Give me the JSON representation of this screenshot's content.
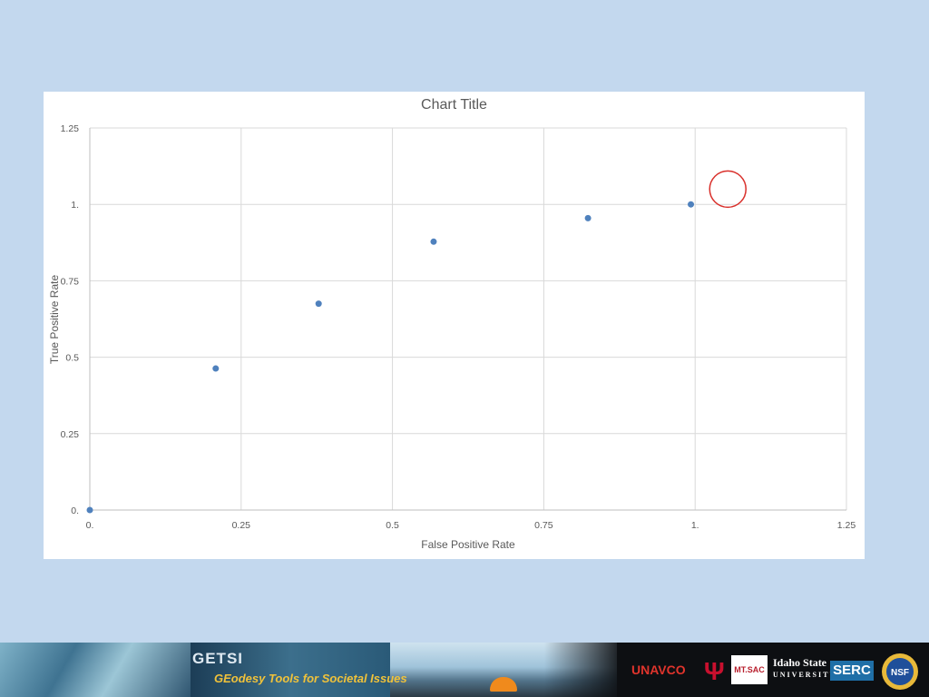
{
  "chart_data": {
    "type": "scatter",
    "title": "Chart Title",
    "xlabel": "False Positive Rate",
    "ylabel": "True Positive Rate",
    "xlim": [
      0,
      1.25
    ],
    "ylim": [
      0,
      1.25
    ],
    "x_ticks": [
      "0.",
      "0.25",
      "0.5",
      "0.75",
      "1.",
      "1.25"
    ],
    "y_ticks": [
      "0.",
      "0.25",
      "0.5",
      "0.75",
      "1.",
      "1.25"
    ],
    "grid": true,
    "series": [
      {
        "points": [
          {
            "x": 0,
            "y": 0
          },
          {
            "x": 0.208,
            "y": 0.463
          },
          {
            "x": 0.378,
            "y": 0.675
          },
          {
            "x": 0.568,
            "y": 0.878
          },
          {
            "x": 0.823,
            "y": 0.955
          },
          {
            "x": 0.993,
            "y": 1.0
          }
        ]
      }
    ],
    "annotation": {
      "type": "circle",
      "x": 1.054,
      "y": 1.05,
      "color": "#d9302b"
    },
    "colors": {
      "marker": "#4f81bd",
      "grid": "#d9d9d9",
      "axis": "#bfbfbf"
    }
  },
  "footer": {
    "getsi_name": "GETSI",
    "getsi_tagline": "GEodesy Tools for Societal Issues",
    "logos": {
      "unavco": "UNAVCO",
      "iu": "Ψ",
      "mtsac": "MT.SAC",
      "isu_line1": "Idaho State",
      "isu_line2": "UNIVERSITY",
      "serc": "SERC",
      "nsf": "NSF"
    }
  }
}
